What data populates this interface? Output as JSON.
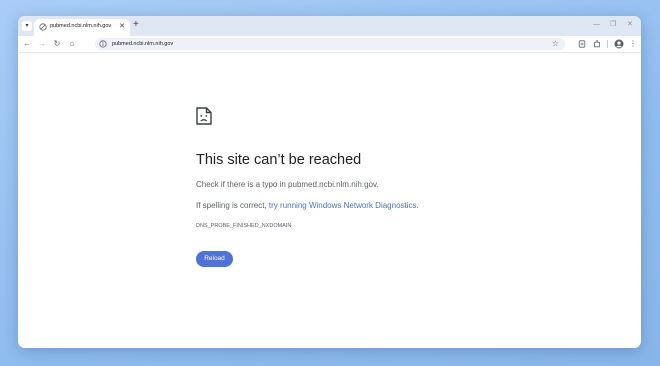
{
  "browser": {
    "tab": {
      "title": "pubmed.ncbi.nlm.nih.gov",
      "close": "✕"
    },
    "new_tab": "+",
    "window_controls": {
      "minimize": "—",
      "maximize": "❐",
      "close": "✕"
    },
    "toolbar": {
      "back": "←",
      "forward": "→",
      "refresh": "↻",
      "home": "⌂",
      "address": "pubmed.ncbi.nlm.nih.gov",
      "bookmark": "☆",
      "menu": "⋮"
    }
  },
  "error_page": {
    "title": "This site can’t be reached",
    "typo_text": "Check if there is a typo in pubmed.ncbi.nlm.nih.gov.",
    "spelling_prefix": "If spelling is correct, ",
    "diagnostics_link": "try running Windows Network Diagnostics",
    "spelling_suffix": ".",
    "error_code": "DNS_PROBE_FINISHED_NXDOMAIN",
    "reload_label": "Reload"
  },
  "colors": {
    "accent": "#4f72d6",
    "link": "#4b74c4",
    "tabbar": "#dfe7f5"
  }
}
